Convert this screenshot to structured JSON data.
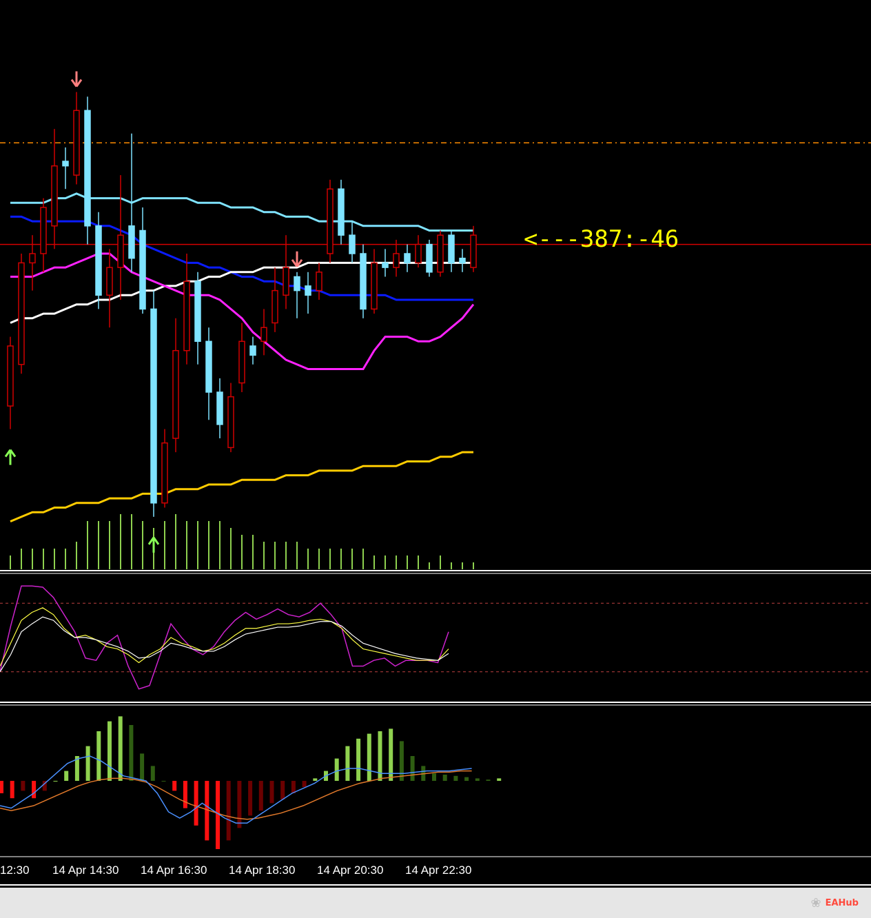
{
  "chart_data": {
    "type": "candlestick",
    "x_tick_labels": [
      "12:30",
      "14 Apr 14:30",
      "14 Apr 16:30",
      "14 Apr 18:30",
      "14 Apr 20:30",
      "14 Apr 22:30"
    ],
    "annotation": "<---387:-46",
    "price_range": [
      0,
      100
    ],
    "candles": [
      {
        "o": 27,
        "c": 40,
        "h": 42,
        "l": 22,
        "dir": "bear"
      },
      {
        "o": 36,
        "c": 58,
        "h": 60,
        "l": 34,
        "dir": "bear"
      },
      {
        "o": 58,
        "c": 60,
        "h": 64,
        "l": 52,
        "dir": "bear"
      },
      {
        "o": 60,
        "c": 70,
        "h": 72,
        "l": 56,
        "dir": "bear"
      },
      {
        "o": 66,
        "c": 79,
        "h": 87,
        "l": 61,
        "dir": "bear"
      },
      {
        "o": 79,
        "c": 80,
        "h": 83,
        "l": 74,
        "dir": "bull"
      },
      {
        "o": 77,
        "c": 91,
        "h": 95,
        "l": 75,
        "dir": "bear"
      },
      {
        "o": 91,
        "c": 66,
        "h": 94,
        "l": 62,
        "dir": "bull"
      },
      {
        "o": 66,
        "c": 51,
        "h": 69,
        "l": 48,
        "dir": "bull"
      },
      {
        "o": 51,
        "c": 57,
        "h": 61,
        "l": 44,
        "dir": "bear"
      },
      {
        "o": 57,
        "c": 64,
        "h": 77,
        "l": 50,
        "dir": "bear"
      },
      {
        "o": 66,
        "c": 59,
        "h": 86,
        "l": 56,
        "dir": "bull"
      },
      {
        "o": 65,
        "c": 48,
        "h": 70,
        "l": 47,
        "dir": "bull"
      },
      {
        "o": 48,
        "c": 6,
        "h": 52,
        "l": 3,
        "dir": "bull"
      },
      {
        "o": 6,
        "c": 19,
        "h": 22,
        "l": 5,
        "dir": "bear"
      },
      {
        "o": 20,
        "c": 39,
        "h": 46,
        "l": 17,
        "dir": "bear"
      },
      {
        "o": 39,
        "c": 54,
        "h": 60,
        "l": 36,
        "dir": "bear"
      },
      {
        "o": 54,
        "c": 41,
        "h": 56,
        "l": 36,
        "dir": "bull"
      },
      {
        "o": 41,
        "c": 30,
        "h": 44,
        "l": 24,
        "dir": "bull"
      },
      {
        "o": 30,
        "c": 23,
        "h": 33,
        "l": 20,
        "dir": "bull"
      },
      {
        "o": 18,
        "c": 29,
        "h": 32,
        "l": 17,
        "dir": "bear"
      },
      {
        "o": 32,
        "c": 41,
        "h": 45,
        "l": 30,
        "dir": "bear"
      },
      {
        "o": 40,
        "c": 38,
        "h": 42,
        "l": 36,
        "dir": "bull"
      },
      {
        "o": 41,
        "c": 44,
        "h": 48,
        "l": 38,
        "dir": "bear"
      },
      {
        "o": 45,
        "c": 52,
        "h": 57,
        "l": 43,
        "dir": "bear"
      },
      {
        "o": 51,
        "c": 57,
        "h": 64,
        "l": 48,
        "dir": "bear"
      },
      {
        "o": 55,
        "c": 52,
        "h": 56,
        "l": 46,
        "dir": "bull"
      },
      {
        "o": 53,
        "c": 51,
        "h": 56,
        "l": 47,
        "dir": "bull"
      },
      {
        "o": 52,
        "c": 56,
        "h": 58,
        "l": 50,
        "dir": "bear"
      },
      {
        "o": 60,
        "c": 74,
        "h": 76,
        "l": 58,
        "dir": "bear"
      },
      {
        "o": 74,
        "c": 64,
        "h": 76,
        "l": 62,
        "dir": "bull"
      },
      {
        "o": 64,
        "c": 60,
        "h": 67,
        "l": 58,
        "dir": "bull"
      },
      {
        "o": 60,
        "c": 48,
        "h": 62,
        "l": 46,
        "dir": "bull"
      },
      {
        "o": 48,
        "c": 58,
        "h": 61,
        "l": 47,
        "dir": "bear"
      },
      {
        "o": 58,
        "c": 57,
        "h": 61,
        "l": 55,
        "dir": "bull"
      },
      {
        "o": 57,
        "c": 60,
        "h": 63,
        "l": 55,
        "dir": "bear"
      },
      {
        "o": 60,
        "c": 58,
        "h": 62,
        "l": 56,
        "dir": "bull"
      },
      {
        "o": 58,
        "c": 62,
        "h": 64,
        "l": 57,
        "dir": "bear"
      },
      {
        "o": 62,
        "c": 56,
        "h": 63,
        "l": 55,
        "dir": "bull"
      },
      {
        "o": 56,
        "c": 64,
        "h": 65,
        "l": 55,
        "dir": "bear"
      },
      {
        "o": 64,
        "c": 58,
        "h": 65,
        "l": 56,
        "dir": "bull"
      },
      {
        "o": 58,
        "c": 59,
        "h": 61,
        "l": 56,
        "dir": "bull"
      },
      {
        "o": 57,
        "c": 64,
        "h": 66,
        "l": 56,
        "dir": "bear"
      }
    ],
    "overlays": [
      {
        "color": "#7fe3ff",
        "values": [
          71,
          71,
          71,
          71,
          72,
          72,
          73,
          72,
          72,
          72,
          72,
          71,
          72,
          72,
          72,
          72,
          72,
          71,
          71,
          71,
          70,
          70,
          70,
          69,
          69,
          68,
          68,
          68,
          67,
          67,
          67,
          67,
          66,
          66,
          66,
          66,
          66,
          66,
          65,
          65,
          65,
          65,
          65
        ]
      },
      {
        "color": "#0a1cff",
        "values": [
          68,
          68,
          67,
          67,
          67,
          67,
          67,
          67,
          66,
          66,
          65,
          64,
          62,
          61,
          60,
          59,
          58,
          58,
          57,
          57,
          56,
          55,
          55,
          54,
          54,
          53,
          53,
          52,
          52,
          51,
          51,
          51,
          51,
          51,
          51,
          50,
          50,
          50,
          50,
          50,
          50,
          50,
          50
        ]
      },
      {
        "color": "#ffffff",
        "values": [
          45,
          46,
          46,
          47,
          47,
          48,
          49,
          49,
          50,
          50,
          51,
          51,
          52,
          52,
          53,
          53,
          54,
          54,
          55,
          55,
          56,
          56,
          56,
          57,
          57,
          57,
          57,
          58,
          58,
          58,
          58,
          58,
          58,
          58,
          58,
          58,
          58,
          58,
          58,
          58,
          58,
          58,
          58
        ]
      },
      {
        "color": "#ff22ff",
        "values": [
          55,
          55,
          55,
          56,
          57,
          57,
          58,
          59,
          60,
          60,
          58,
          56,
          55,
          54,
          53,
          52,
          51,
          51,
          51,
          50,
          48,
          46,
          43,
          41,
          39,
          37,
          36,
          35,
          35,
          35,
          35,
          35,
          35,
          39,
          42,
          42,
          42,
          41,
          41,
          42,
          44,
          46,
          49
        ]
      }
    ],
    "lower_band": [
      2,
      3,
      4,
      4,
      5,
      5,
      6,
      6,
      6,
      7,
      7,
      7,
      8,
      8,
      8,
      9,
      9,
      9,
      10,
      10,
      10,
      11,
      11,
      11,
      11,
      12,
      12,
      12,
      13,
      13,
      13,
      13,
      14,
      14,
      14,
      14,
      15,
      15,
      15,
      16,
      16,
      17,
      17
    ],
    "horizontal_lines": [
      {
        "price": 84,
        "color": "#ff8c00",
        "style": "dashdot"
      },
      {
        "price": 62,
        "color": "#d60000",
        "style": "solid"
      }
    ],
    "arrows": [
      {
        "index": 6,
        "dir": "down"
      },
      {
        "index": 26,
        "dir": "down"
      },
      {
        "index": 0,
        "dir": "up"
      },
      {
        "index": 13,
        "dir": "up"
      }
    ],
    "volume": [
      2,
      3,
      3,
      3,
      3,
      3,
      4,
      7,
      7,
      7,
      8,
      8,
      7,
      6,
      7,
      8,
      7,
      7,
      7,
      7,
      6,
      5,
      5,
      4,
      4,
      4,
      4,
      3,
      3,
      3,
      3,
      3,
      3,
      2,
      2,
      2,
      2,
      2,
      1,
      2,
      1,
      1,
      1
    ],
    "stochastic": {
      "levels": [
        80,
        20
      ],
      "k": [
        20,
        60,
        95,
        95,
        94,
        85,
        70,
        55,
        32,
        30,
        45,
        52,
        25,
        5,
        8,
        35,
        62,
        50,
        40,
        35,
        42,
        55,
        65,
        72,
        66,
        70,
        75,
        70,
        68,
        72,
        80,
        70,
        58,
        25,
        25,
        30,
        32,
        25,
        30,
        30,
        30,
        28,
        55
      ],
      "main": [
        25,
        45,
        65,
        72,
        76,
        70,
        58,
        50,
        52,
        48,
        42,
        40,
        35,
        28,
        35,
        40,
        50,
        45,
        42,
        38,
        40,
        45,
        52,
        58,
        58,
        60,
        62,
        62,
        63,
        65,
        66,
        64,
        58,
        48,
        40,
        38,
        36,
        34,
        32,
        30,
        30,
        30,
        40
      ],
      "signal": [
        20,
        35,
        55,
        62,
        68,
        65,
        56,
        50,
        50,
        48,
        45,
        42,
        38,
        32,
        33,
        38,
        45,
        43,
        40,
        38,
        38,
        42,
        48,
        53,
        55,
        57,
        59,
        59,
        60,
        62,
        64,
        64,
        60,
        52,
        45,
        42,
        39,
        36,
        34,
        32,
        31,
        30,
        36
      ]
    },
    "macd": {
      "hist": [
        -10,
        -14,
        -8,
        -14,
        -8,
        0,
        8,
        20,
        28,
        40,
        48,
        52,
        45,
        22,
        12,
        0,
        -8,
        -22,
        -36,
        -48,
        -55,
        -48,
        -38,
        -28,
        -24,
        -18,
        -15,
        -10,
        -5,
        2,
        8,
        18,
        28,
        34,
        38,
        40,
        42,
        32,
        20,
        12,
        6,
        5,
        4,
        3,
        2,
        1,
        2
      ],
      "line": [
        -20,
        -22,
        -16,
        -10,
        -2,
        6,
        14,
        18,
        20,
        16,
        10,
        4,
        2,
        0,
        -10,
        -25,
        -30,
        -25,
        -18,
        -24,
        -30,
        -34,
        -34,
        -28,
        -22,
        -16,
        -10,
        -6,
        -2,
        4,
        8,
        10,
        10,
        8,
        6,
        6,
        6,
        7,
        8,
        8,
        8,
        9,
        10
      ],
      "signal": [
        -22,
        -24,
        -22,
        -20,
        -16,
        -12,
        -8,
        -4,
        -1,
        1,
        2,
        2,
        1,
        -1,
        -5,
        -10,
        -15,
        -19,
        -22,
        -25,
        -28,
        -30,
        -31,
        -30,
        -28,
        -26,
        -23,
        -20,
        -16,
        -12,
        -8,
        -5,
        -2,
        0,
        2,
        3,
        4,
        5,
        6,
        7,
        7,
        8,
        8
      ]
    }
  },
  "watermark": {
    "brand": "EAHub"
  }
}
